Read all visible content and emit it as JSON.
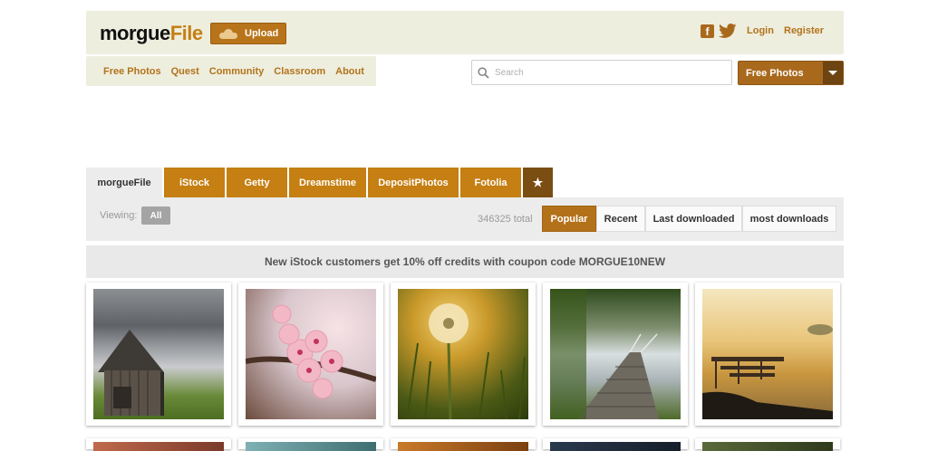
{
  "header": {
    "logo_main": "morgue",
    "logo_accent": "File",
    "upload_label": "Upload",
    "login_label": "Login",
    "register_label": "Register"
  },
  "nav": {
    "items": [
      "Free Photos",
      "Quest",
      "Community",
      "Classroom",
      "About"
    ]
  },
  "search": {
    "placeholder": "Search",
    "category_selected": "Free Photos"
  },
  "tabs": [
    "morgueFile",
    "iStock",
    "Getty",
    "Dreamstime",
    "DepositPhotos",
    "Fotolia",
    "★"
  ],
  "filter": {
    "viewing_label": "Viewing:",
    "viewing_value": "All",
    "total_text": "346325 total",
    "sort_options": [
      "Popular",
      "Recent",
      "Last downloaded",
      "most downloads"
    ],
    "sort_selected": "Popular"
  },
  "promo": {
    "text": "New iStock customers get 10% off credits with coupon code MORGUE10NEW"
  },
  "photos": [
    {
      "subject": "old wooden barn under stormy sky",
      "icon": "barn-photo"
    },
    {
      "subject": "pink cherry blossoms",
      "icon": "blossom-photo"
    },
    {
      "subject": "dandelion seed head at sunset",
      "icon": "dandelion-photo"
    },
    {
      "subject": "wooden boardwalk through misty forest",
      "icon": "boardwalk-photo"
    },
    {
      "subject": "golden lake with pier at sunrise",
      "icon": "pier-photo"
    }
  ],
  "colors": {
    "accent": "#c57f12",
    "header_bg": "#eeeedf",
    "tab_star": "#7a4d12"
  }
}
